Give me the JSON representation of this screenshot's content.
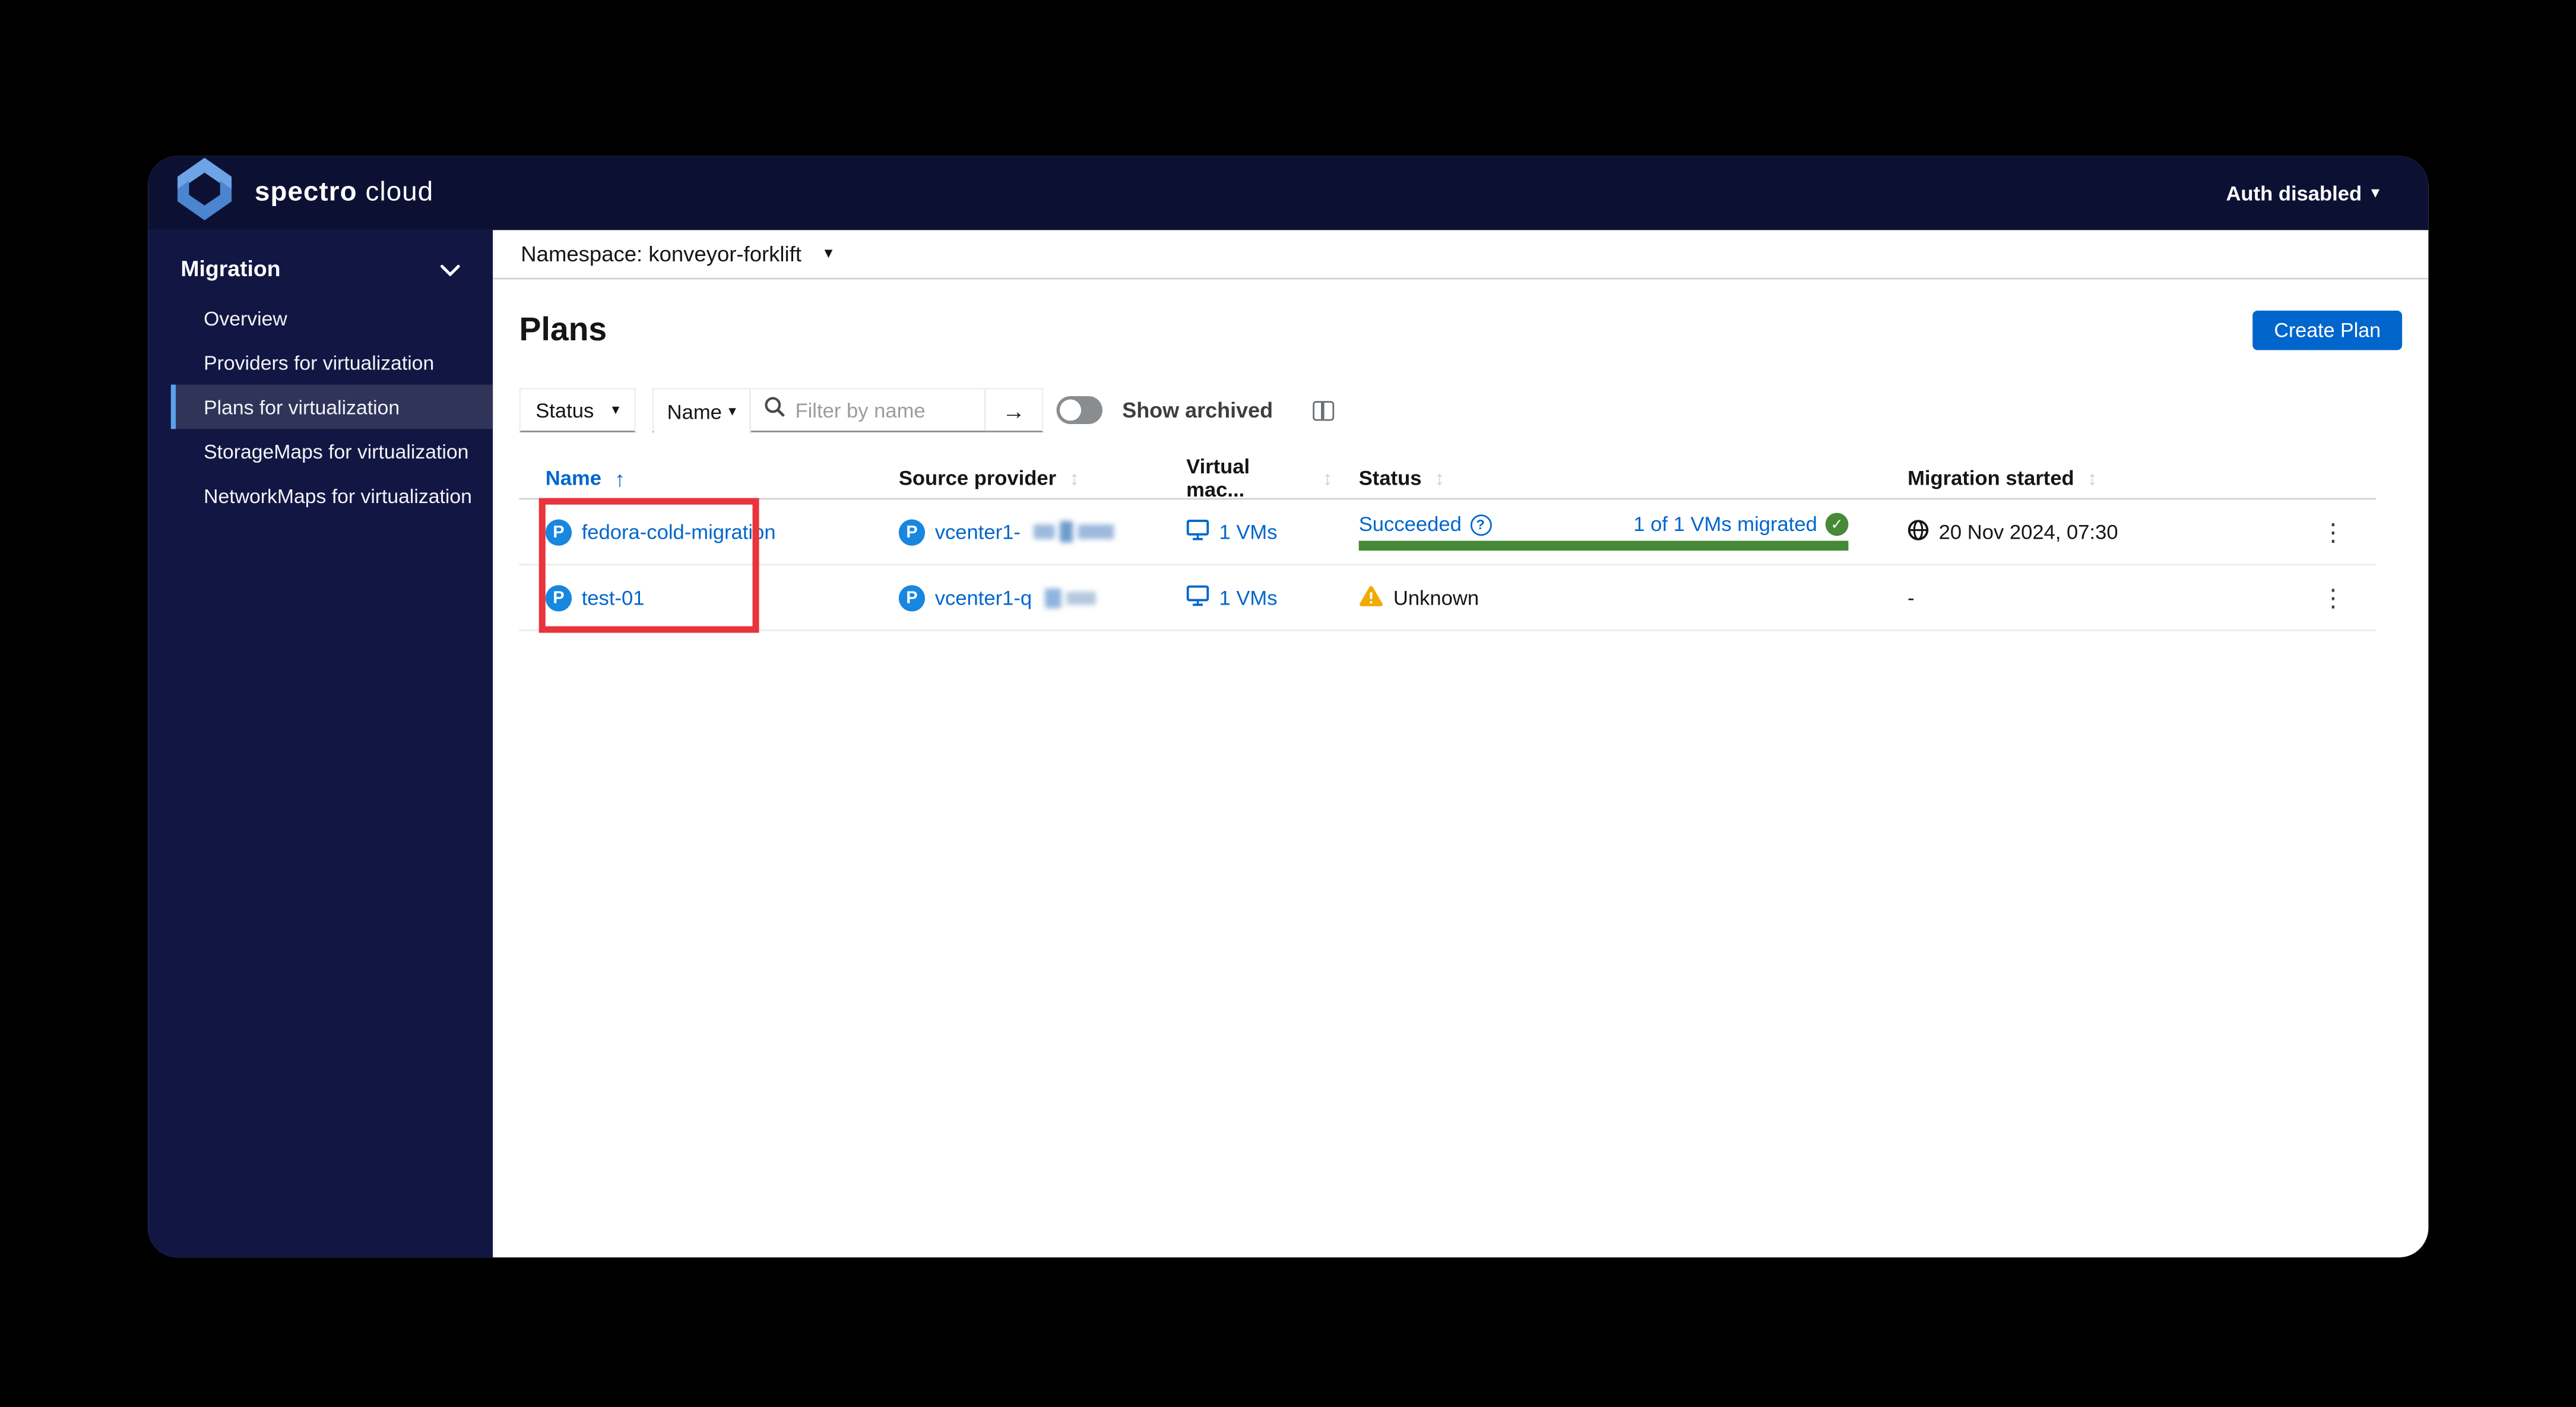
{
  "brand": {
    "name_primary": "spectro",
    "name_secondary": "cloud"
  },
  "header": {
    "auth_label": "Auth disabled"
  },
  "sidebar": {
    "group_label": "Migration",
    "items": [
      {
        "label": "Overview",
        "active": false
      },
      {
        "label": "Providers for virtualization",
        "active": false
      },
      {
        "label": "Plans for virtualization",
        "active": true
      },
      {
        "label": "StorageMaps for virtualization",
        "active": false
      },
      {
        "label": "NetworkMaps for virtualization",
        "active": false
      }
    ]
  },
  "namespace_bar": {
    "label": "Namespace: konveyor-forklift"
  },
  "page": {
    "title": "Plans",
    "create_button_label": "Create Plan"
  },
  "toolbar": {
    "status_filter_label": "Status",
    "name_filter_label": "Name",
    "search_placeholder": "Filter by name",
    "show_archived_label": "Show archived",
    "archived_on": false
  },
  "table": {
    "columns": {
      "name": "Name",
      "source_provider": "Source provider",
      "virtual_machines": "Virtual mac...",
      "status": "Status",
      "migration_started": "Migration started"
    },
    "sorted_column": "Name",
    "rows": [
      {
        "name": "fedora-cold-migration",
        "source_provider": "vcenter1-",
        "vms": "1 VMs",
        "status": "Succeeded",
        "migrated_label": "1 of 1 VMs migrated",
        "progress_pct": 100,
        "migration_started": "20 Nov 2024, 07:30"
      },
      {
        "name": "test-01",
        "source_provider": "vcenter1-q",
        "vms": "1 VMs",
        "status": "Unknown",
        "migration_started": "-"
      }
    ]
  },
  "colors": {
    "accent_blue": "#0066cc",
    "progress_green": "#468936",
    "warning": "#f0ab00",
    "annotation_red": "#e8343c",
    "badge_blue": "#1787e0"
  }
}
